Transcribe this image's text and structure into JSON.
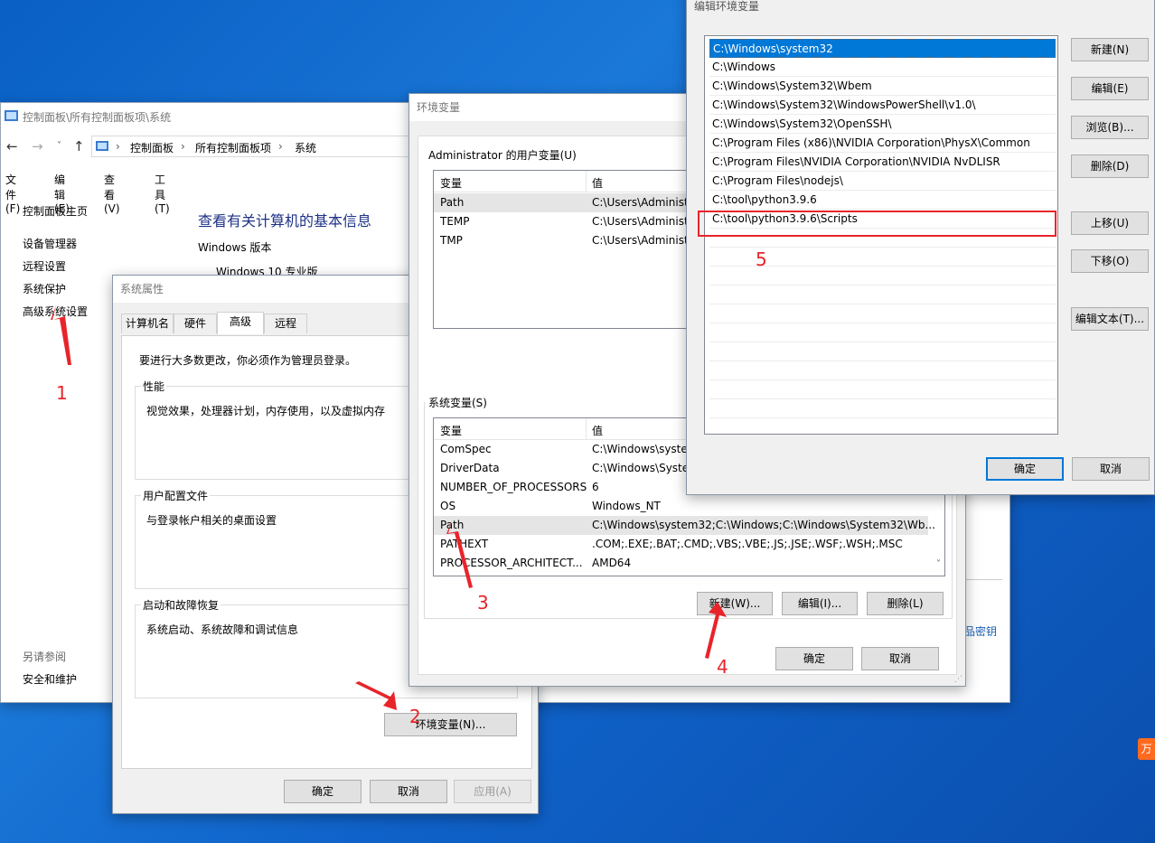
{
  "control_panel": {
    "title": "控制面板\\所有控制面板项\\系统",
    "breadcrumb": [
      "控制面板",
      "所有控制面板项",
      "系统"
    ],
    "menu": [
      "文件(F)",
      "编辑(E)",
      "查看(V)",
      "工具(T)"
    ],
    "sidebar_home": "控制面板主页",
    "sidebar_items": [
      "设备管理器",
      "远程设置",
      "系统保护",
      "高级系统设置"
    ],
    "see_also_label": "另请参阅",
    "see_also_items": [
      "安全和维护"
    ],
    "heading": "查看有关计算机的基本信息",
    "windows_edition_label": "Windows 版本",
    "windows_edition": "Windows 10 专业版",
    "partial_link": "品密钥"
  },
  "sysprops": {
    "title": "系统属性",
    "tabs": [
      "计算机名",
      "硬件",
      "高级",
      "远程"
    ],
    "active_tab": "高级",
    "admin_note": "要进行大多数更改，你必须作为管理员登录。",
    "performance": {
      "label": "性能",
      "desc": "视觉效果，处理器计划，内存使用，以及虚拟内存"
    },
    "user_profile": {
      "label": "用户配置文件",
      "desc": "与登录帐户相关的桌面设置"
    },
    "startup": {
      "label": "启动和故障恢复",
      "desc": "系统启动、系统故障和调试信息"
    },
    "env_button": "环境变量(N)...",
    "ok": "确定",
    "cancel": "取消",
    "apply": "应用(A)"
  },
  "envvars": {
    "title": "环境变量",
    "user_group": "Administrator 的用户变量(U)",
    "col_var": "变量",
    "col_val": "值",
    "user_vars": [
      {
        "name": "Path",
        "value": "C:\\Users\\Administ"
      },
      {
        "name": "TEMP",
        "value": "C:\\Users\\Administ"
      },
      {
        "name": "TMP",
        "value": "C:\\Users\\Administ"
      }
    ],
    "sys_group": "系统变量(S)",
    "sys_vars": [
      {
        "name": "ComSpec",
        "value": "C:\\Windows\\syster"
      },
      {
        "name": "DriverData",
        "value": "C:\\Windows\\Syster"
      },
      {
        "name": "NUMBER_OF_PROCESSORS",
        "value": "6"
      },
      {
        "name": "OS",
        "value": "Windows_NT"
      },
      {
        "name": "Path",
        "value": "C:\\Windows\\system32;C:\\Windows;C:\\Windows\\System32\\Wb..."
      },
      {
        "name": "PATHEXT",
        "value": ".COM;.EXE;.BAT;.CMD;.VBS;.VBE;.JS;.JSE;.WSF;.WSH;.MSC"
      },
      {
        "name": "PROCESSOR_ARCHITECT...",
        "value": "AMD64"
      }
    ],
    "new_button": "新建(W)...",
    "edit_button": "编辑(I)...",
    "delete_button": "删除(L)",
    "ok": "确定",
    "cancel": "取消"
  },
  "editenv": {
    "title": "编辑环境变量",
    "entries": [
      "C:\\Windows\\system32",
      "C:\\Windows",
      "C:\\Windows\\System32\\Wbem",
      "C:\\Windows\\System32\\WindowsPowerShell\\v1.0\\",
      "C:\\Windows\\System32\\OpenSSH\\",
      "C:\\Program Files (x86)\\NVIDIA Corporation\\PhysX\\Common",
      "C:\\Program Files\\NVIDIA Corporation\\NVIDIA NvDLISR",
      "C:\\Program Files\\nodejs\\",
      "C:\\tool\\python3.9.6",
      "C:\\tool\\python3.9.6\\Scripts"
    ],
    "buttons": [
      "新建(N)",
      "编辑(E)",
      "浏览(B)...",
      "删除(D)",
      "上移(U)",
      "下移(O)",
      "编辑文本(T)..."
    ],
    "ok": "确定",
    "cancel": "取消"
  },
  "annotations": [
    "1",
    "2",
    "3",
    "4",
    "5"
  ],
  "colors": {
    "annotation": "#e8242b",
    "selection": "#0078d7",
    "link": "#1a5fb4"
  }
}
